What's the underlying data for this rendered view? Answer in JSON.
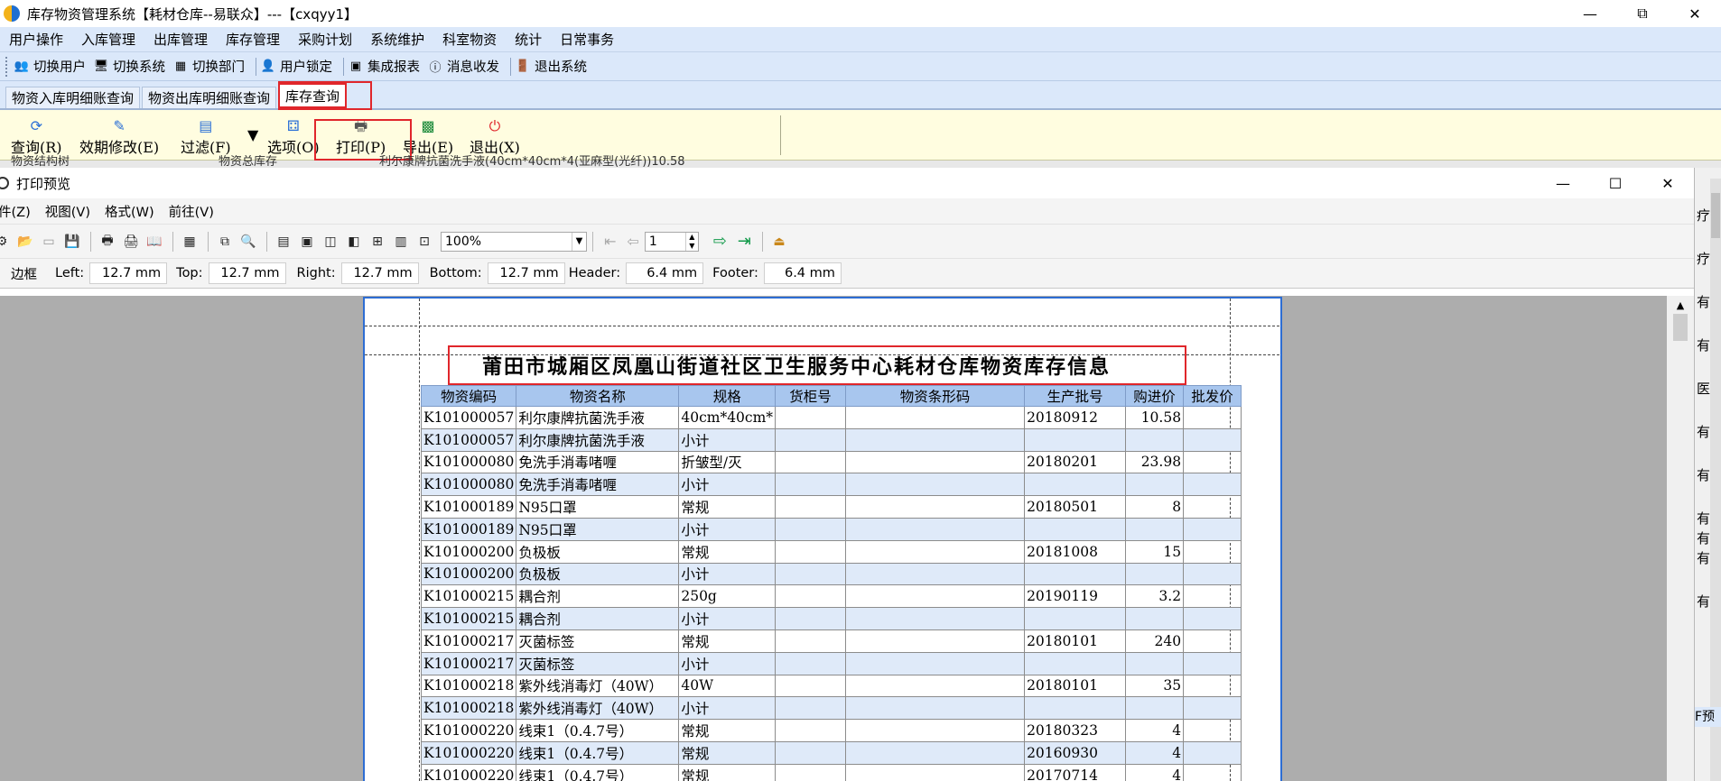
{
  "window": {
    "title": "库存物资管理系统【耗材仓库--易联众】---【cxqyy1】",
    "minimize": "—",
    "maximize": "⧉",
    "close": "✕"
  },
  "menubar": [
    "用户操作",
    "入库管理",
    "出库管理",
    "库存管理",
    "采购计划",
    "系统维护",
    "科室物资",
    "统计",
    "日常事务"
  ],
  "toolbar": [
    "切换用户",
    "切换系统",
    "切换部门",
    "用户锁定",
    "集成报表",
    "消息收发",
    "退出系统"
  ],
  "tabs": [
    "物资入库明细账查询",
    "物资出库明细账查询",
    "库存查询"
  ],
  "active_tab": "库存查询",
  "ribbon": [
    "查询(R)",
    "效期修改(E)",
    "过滤(F)",
    "选项(O)",
    "打印(P)",
    "导出(E)",
    "退出(X)"
  ],
  "behind_text": {
    "left": "物资结构树",
    "mid": "物资总库存",
    "right": "利尔康牌抗菌洗手液(40cm*40cm*4(亚麻型(光纤))10.58"
  },
  "right_strip": [
    "疗",
    "疗",
    "有",
    "有",
    "医",
    "有",
    "有",
    "有",
    "有",
    "有",
    "有"
  ],
  "right_strip_footer": "F预",
  "preview": {
    "title": "打印预览",
    "menu": [
      "件(Z)",
      "视图(V)",
      "格式(W)",
      "前往(V)"
    ],
    "zoom": "100%",
    "page": "1",
    "margins": {
      "border_label": "边框",
      "left_label": "Left:",
      "left": "12.7 mm",
      "top_label": "Top:",
      "top": "12.7 mm",
      "right_label": "Right:",
      "right": "12.7 mm",
      "bottom_label": "Bottom:",
      "bottom": "12.7 mm",
      "header_label": "Header:",
      "header": "6.4 mm",
      "footer_label": "Footer:",
      "footer": "6.4 mm"
    }
  },
  "report": {
    "title": "莆田市城厢区凤凰山街道社区卫生服务中心耗材仓库物资库存信息",
    "columns": [
      "物资编码",
      "物资名称",
      "规格",
      "货柜号",
      "物资条形码",
      "生产批号",
      "购进价",
      "批发价"
    ],
    "rows": [
      [
        "K101000057",
        "利尔康牌抗菌洗手液",
        "40cm*40cm*",
        "",
        "",
        "20180912",
        "10.58",
        ""
      ],
      [
        "K101000057",
        "利尔康牌抗菌洗手液",
        "小计",
        "",
        "",
        "",
        "",
        ""
      ],
      [
        "K101000080",
        "免洗手消毒啫喱",
        "折皱型/灭",
        "",
        "",
        "20180201",
        "23.98",
        ""
      ],
      [
        "K101000080",
        "免洗手消毒啫喱",
        "小计",
        "",
        "",
        "",
        "",
        ""
      ],
      [
        "K101000189",
        "N95口罩",
        "常规",
        "",
        "",
        "20180501",
        "8",
        ""
      ],
      [
        "K101000189",
        "N95口罩",
        "小计",
        "",
        "",
        "",
        "",
        ""
      ],
      [
        "K101000200",
        "负极板",
        "常规",
        "",
        "",
        "20181008",
        "15",
        ""
      ],
      [
        "K101000200",
        "负极板",
        "小计",
        "",
        "",
        "",
        "",
        ""
      ],
      [
        "K101000215",
        "耦合剂",
        "250g",
        "",
        "",
        "20190119",
        "3.2",
        ""
      ],
      [
        "K101000215",
        "耦合剂",
        "小计",
        "",
        "",
        "",
        "",
        ""
      ],
      [
        "K101000217",
        "灭菌标签",
        "常规",
        "",
        "",
        "20180101",
        "240",
        ""
      ],
      [
        "K101000217",
        "灭菌标签",
        "小计",
        "",
        "",
        "",
        "",
        ""
      ],
      [
        "K101000218",
        "紫外线消毒灯（40W）",
        "40W",
        "",
        "",
        "20180101",
        "35",
        ""
      ],
      [
        "K101000218",
        "紫外线消毒灯（40W）",
        "小计",
        "",
        "",
        "",
        "",
        ""
      ],
      [
        "K101000220",
        "线束1（0.4.7号）",
        "常规",
        "",
        "",
        "20180323",
        "4",
        ""
      ],
      [
        "K101000220",
        "线束1（0.4.7号）",
        "常规",
        "",
        "",
        "20160930",
        "4",
        ""
      ],
      [
        "K101000220",
        "线束1（0.4.7号）",
        "常规",
        "",
        "",
        "20170714",
        "4",
        ""
      ]
    ]
  }
}
